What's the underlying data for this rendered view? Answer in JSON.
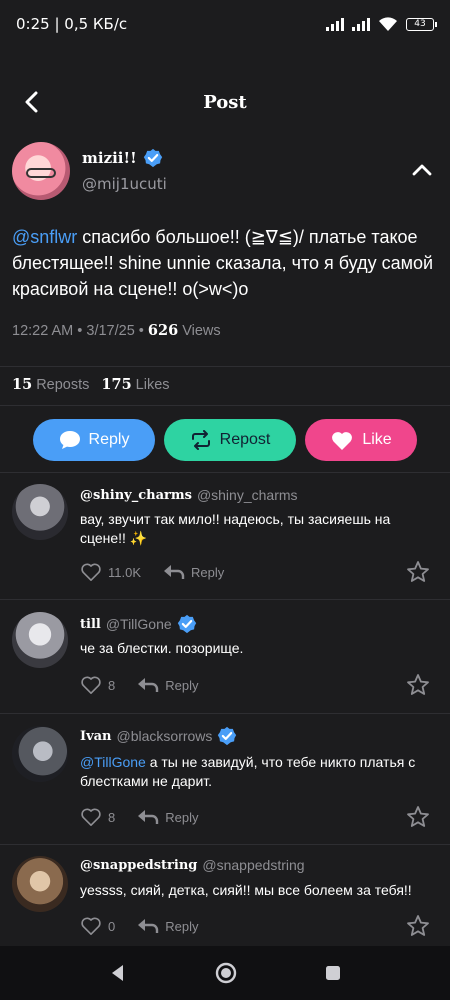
{
  "status_bar": {
    "left_text": "0:25 | 0,5 КБ/с",
    "battery": "43"
  },
  "header": {
    "title": "Post"
  },
  "post": {
    "author_name": "mizii!!",
    "author_handle": "@mij1ucuti",
    "mention": "@snflwr",
    "text": "спасибо большое!! (≧∇≦)/ платье такое блестящее!! shine unnie сказала, что я буду самой красивой на сцене!! o(>w<)o",
    "timestamp": "12:22 AM • 3/17/25 •",
    "views_count": "626",
    "views_label": "Views",
    "reposts_count": "15",
    "reposts_label": "Reposts",
    "likes_count": "175",
    "likes_label": "Likes"
  },
  "actions": {
    "reply_label": "Reply",
    "repost_label": "Repost",
    "like_label": "Like"
  },
  "comments": [
    {
      "name": "@shiny_charms",
      "handle": "@shiny_charms",
      "verified": false,
      "mention": "",
      "text": "вау, звучит так мило!! надеюсь, ты засияешь на сцене!! ✨",
      "likes": "11.0K",
      "reply_label": "Reply"
    },
    {
      "name": "till",
      "handle": "@TillGone",
      "verified": true,
      "mention": "",
      "text": "че за блестки. позорище.",
      "likes": "8",
      "reply_label": "Reply"
    },
    {
      "name": "Ivan",
      "handle": "@blacksorrows",
      "verified": true,
      "mention": "@TillGone",
      "text": " а ты не завидуй, что тебе никто платья с блестками не дарит.",
      "likes": "8",
      "reply_label": "Reply"
    },
    {
      "name": "@snappedstring",
      "handle": "@snappedstring",
      "verified": false,
      "mention": "",
      "text": "yessss, сияй, детка, сияй!! мы все болеем за тебя!!",
      "likes": "0",
      "reply_label": "Reply"
    }
  ],
  "colors": {
    "accent_blue": "#4a9ef7",
    "repost_green": "#2ed3a2",
    "like_pink": "#f0468c",
    "background": "#1c1c1e"
  }
}
